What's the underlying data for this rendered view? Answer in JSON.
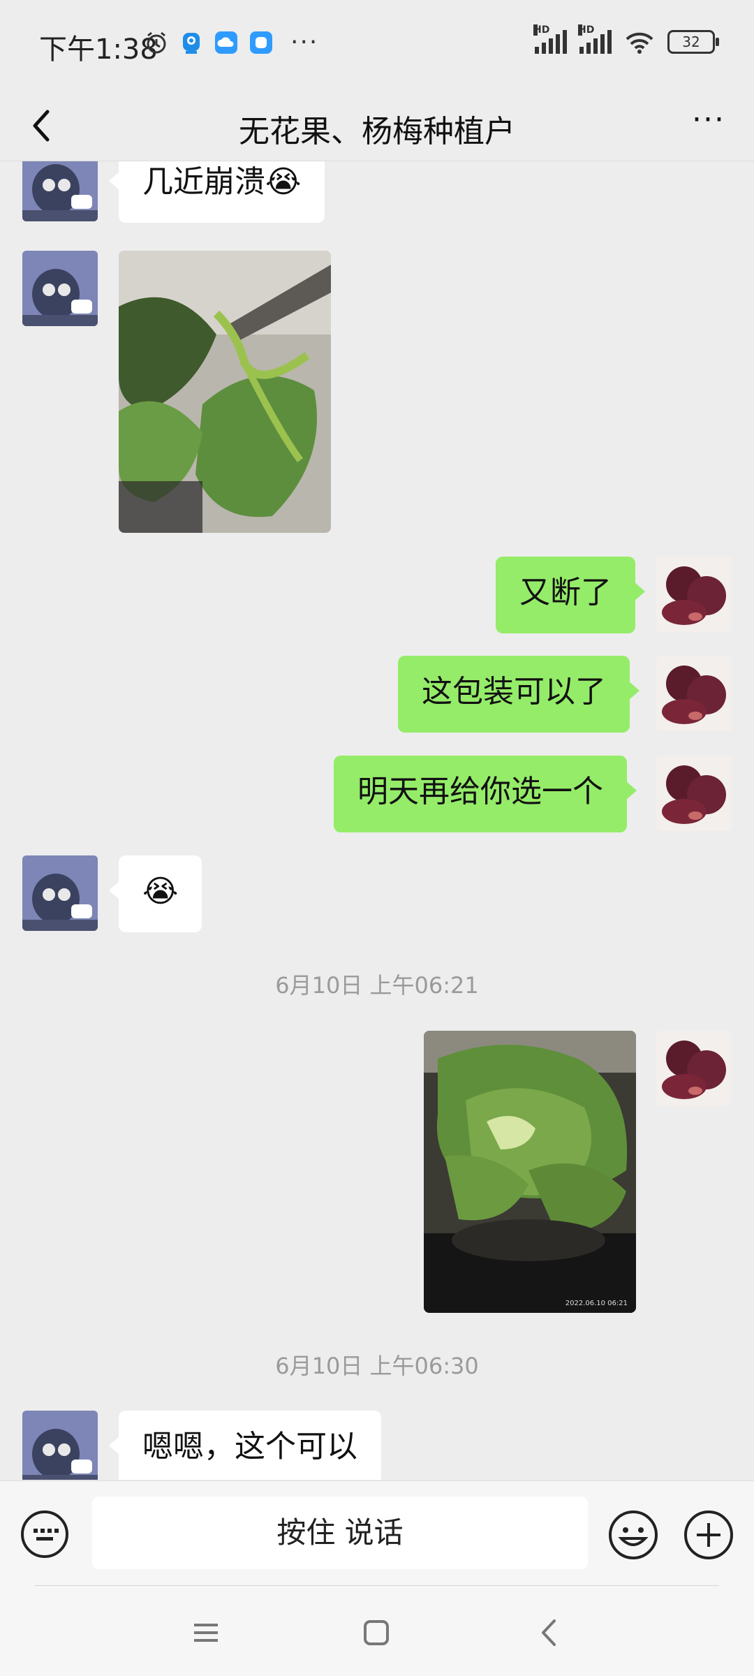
{
  "status_bar": {
    "time": "下午1:38",
    "signal_1_label": "HD",
    "signal_2_label": "HD",
    "battery": "32",
    "more": "···"
  },
  "nav": {
    "title": "无花果、杨梅种植户",
    "more": "···"
  },
  "messages": {
    "m1": "几近崩溃😭",
    "m3": "又断了",
    "m4": "这包装可以了",
    "m5": "明天再给你选一个",
    "m6": "😭",
    "ts1": "6月10日 上午06:21",
    "ts2": "6月10日 上午06:30",
    "m8": "嗯嗯，这个可以"
  },
  "photo_watermark": "2022.06.10 06:21",
  "composer": {
    "voice_label": "按住 说话"
  },
  "colors": {
    "background": "#ededed",
    "bubble_mine": "#95ec69",
    "bubble_other": "#ffffff",
    "timestamp": "#9a9a9a"
  }
}
